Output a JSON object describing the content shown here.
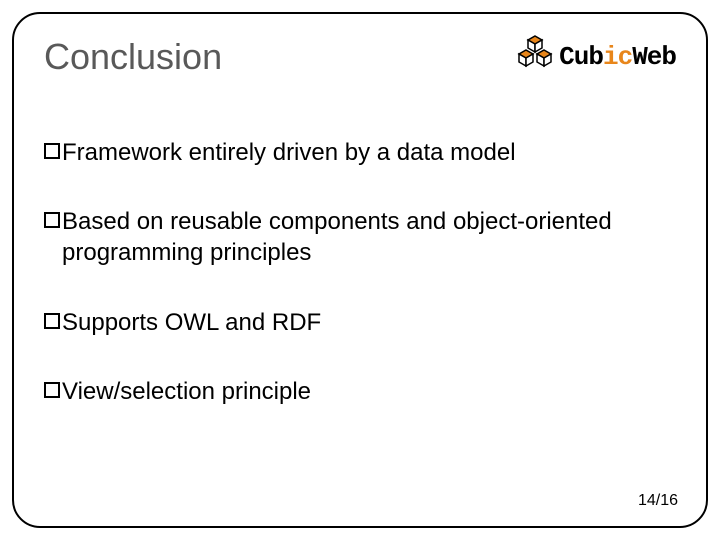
{
  "slide": {
    "title": "Conclusion",
    "logo": {
      "brand_part1": "Cub",
      "brand_part2": "ic",
      "brand_part3": "Web"
    },
    "bullets": [
      "Framework entirely driven by a data model",
      "Based on reusable components and object-oriented programming principles",
      "Supports OWL and RDF",
      "View/selection principle"
    ],
    "page": "14/16"
  }
}
